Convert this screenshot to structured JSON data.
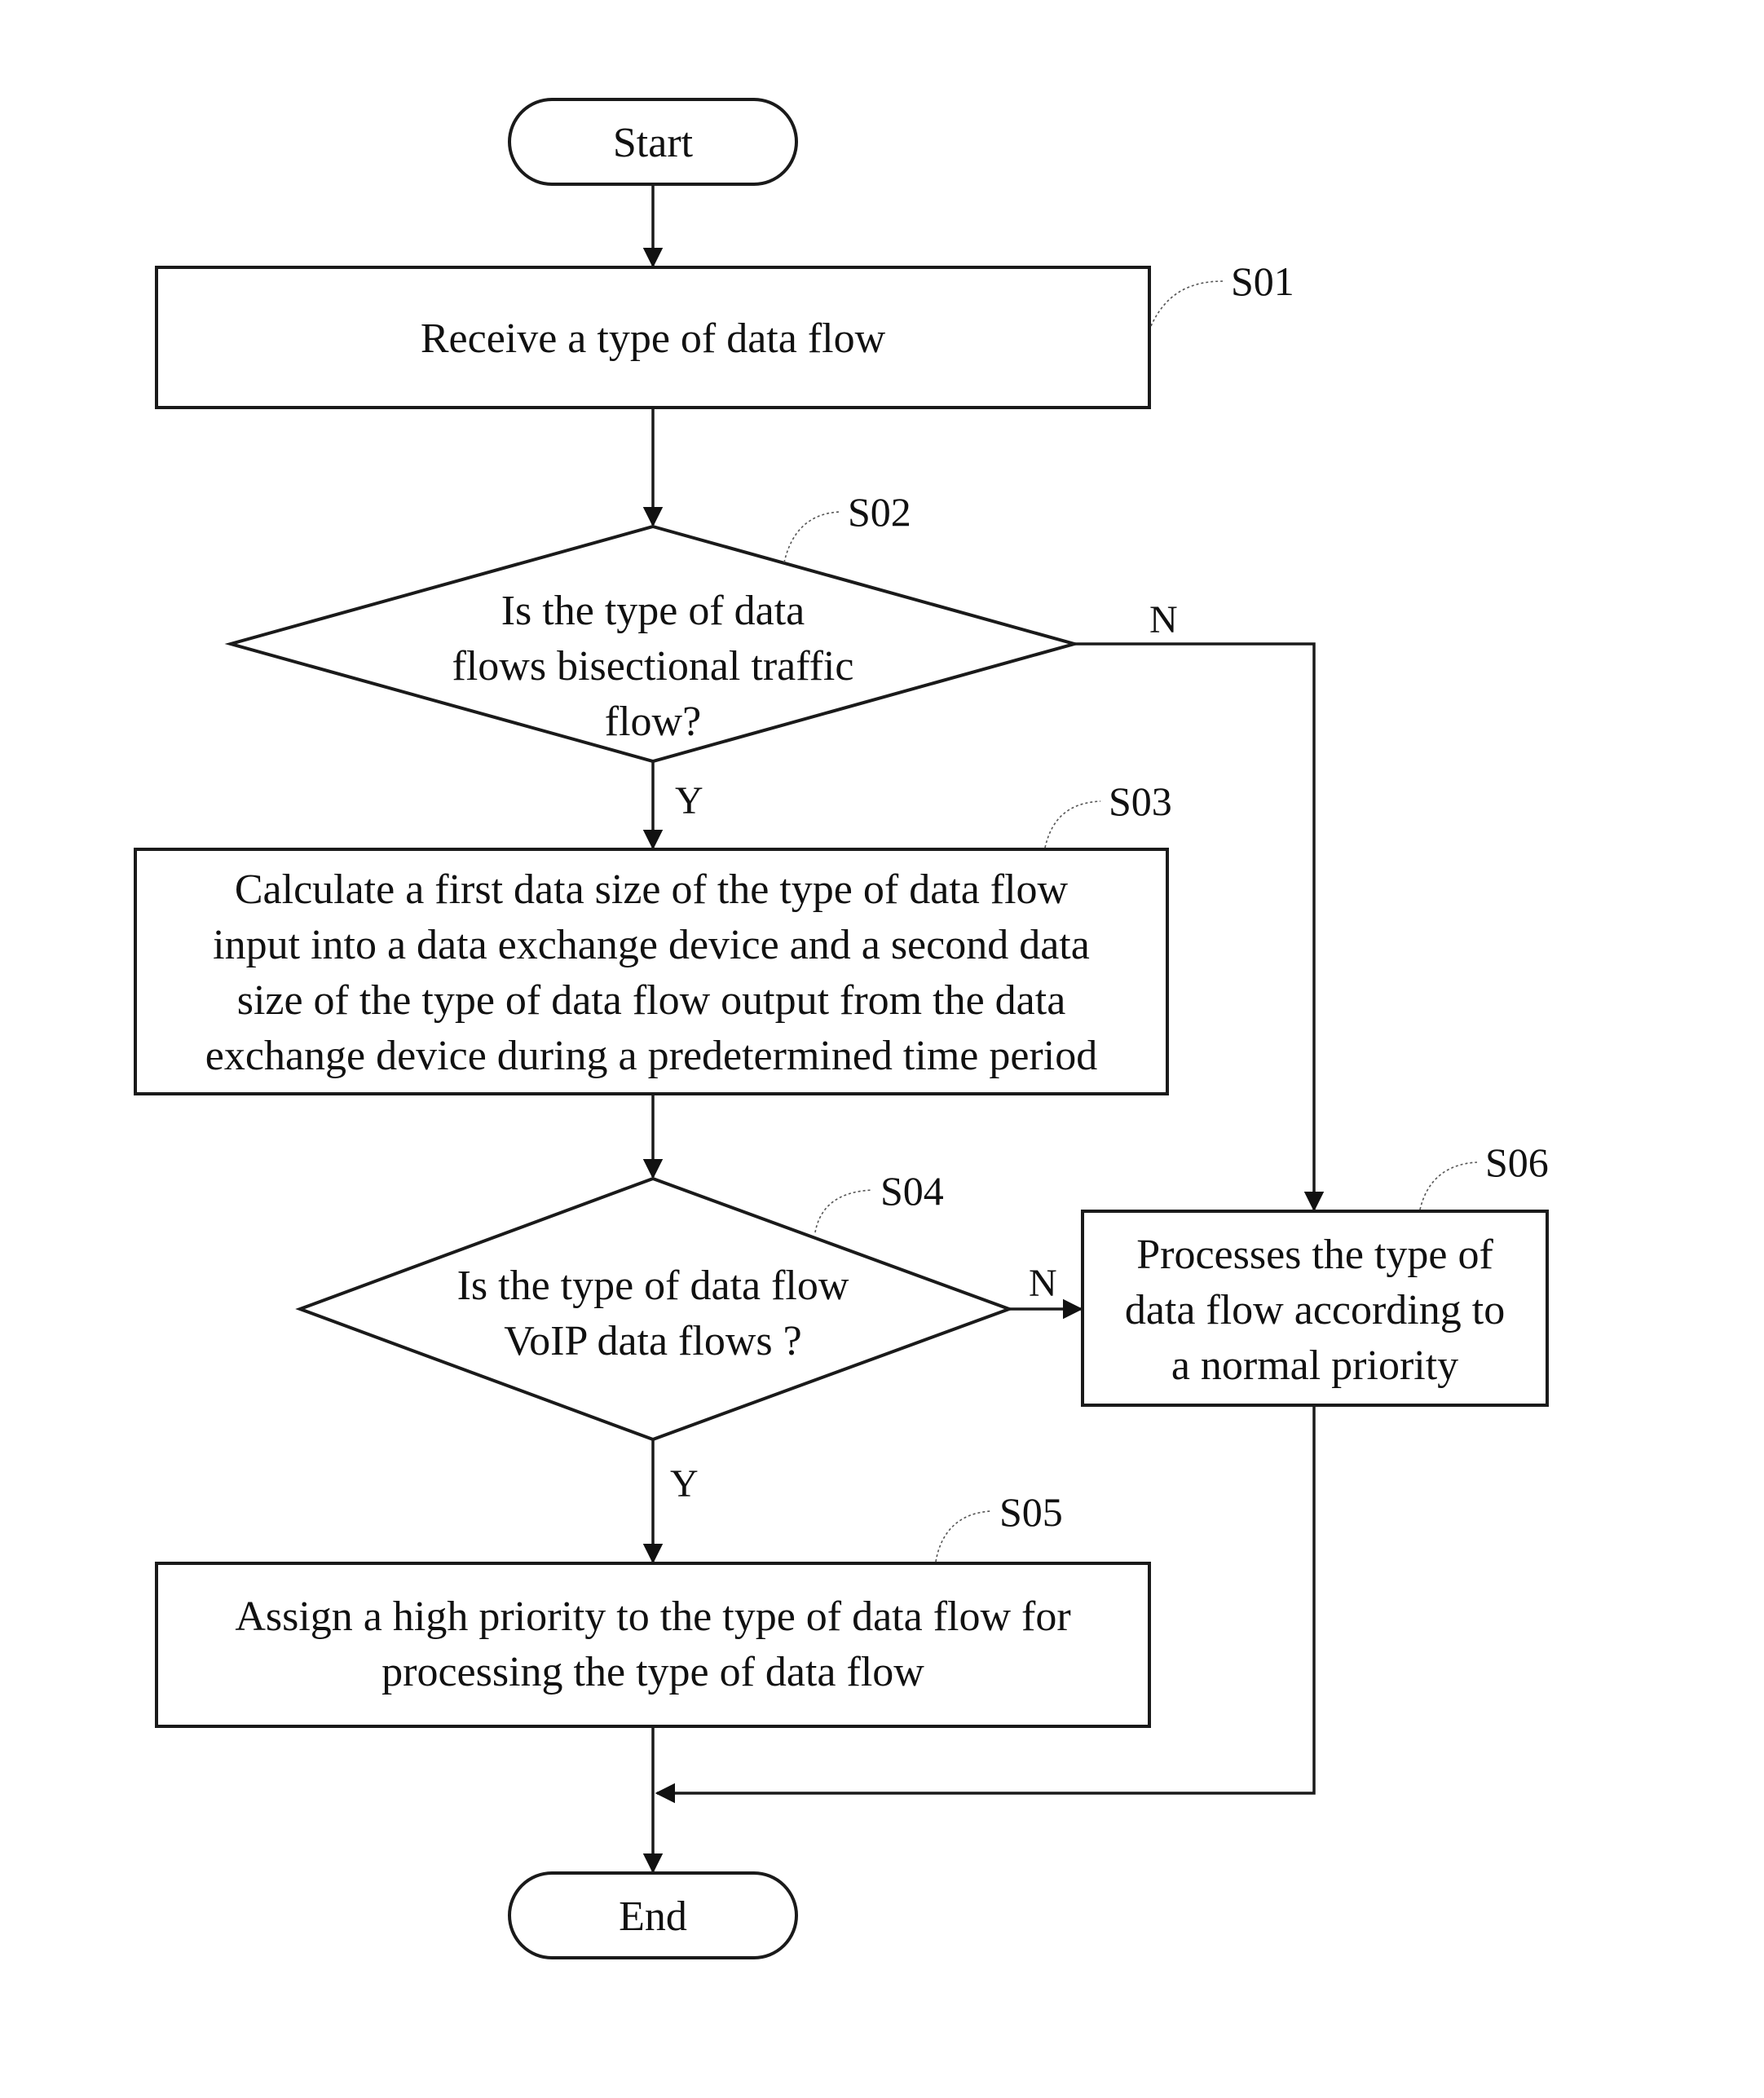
{
  "diagram": {
    "type": "flowchart",
    "nodes": {
      "start": {
        "label": "Start"
      },
      "s01": {
        "step": "S01",
        "lines": [
          "Receive a type of data flow"
        ]
      },
      "s02": {
        "step": "S02",
        "lines": [
          "Is the type of data",
          "flows bisectional traffic",
          "flow?"
        ]
      },
      "s03": {
        "step": "S03",
        "lines": [
          "Calculate a first data size of the type of data flow",
          "input into a data exchange device and a second data",
          "size of the type of data flow output from the data",
          "exchange device during a predetermined time period"
        ]
      },
      "s04": {
        "step": "S04",
        "lines": [
          "Is the type of data flow",
          "VoIP data flows ?"
        ]
      },
      "s05": {
        "step": "S05",
        "lines": [
          "Assign a high priority to the type of data flow for",
          "processing the type of data flow"
        ]
      },
      "s06": {
        "step": "S06",
        "lines": [
          "Processes the type of",
          "data flow according to",
          "a normal priority"
        ]
      },
      "end": {
        "label": "End"
      }
    },
    "branch_labels": {
      "s02_yes": "Y",
      "s02_no": "N",
      "s04_yes": "Y",
      "s04_no": "N"
    }
  }
}
